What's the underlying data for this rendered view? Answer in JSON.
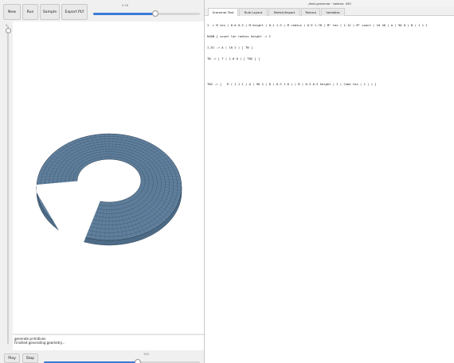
{
  "toolbar": {
    "new": "New",
    "run": "Run",
    "sample": "Sample",
    "export_ply": "Export PLY",
    "slider_value": "0.58",
    "slider_fraction": 0.58
  },
  "viewport": {
    "vertical_slider_value": "0",
    "ring_color": "#5f7f9c",
    "ring_edge_color": "#263a4d"
  },
  "console": {
    "line1": "generate primitives",
    "line2": "Finished generating geometry..."
  },
  "bottombar": {
    "play": "Play",
    "stop": "Stop",
    "slider_value": "150",
    "slider_fraction": 0.6
  },
  "editor_window": {
    "title": "./test.grammar · tokens: 450",
    "tabs": [
      "Grammar Text",
      "Rule Layout",
      "Sketch/Import",
      "Texture",
      "Variables"
    ],
    "active_tab": 0,
    "lines": [
      "I -> M tex ( 0.0 0.3 ) M height ( 0.1 1.3 ) M radius ( 0.9 1.78 ) M^ tex ( 1.12 ) M^ count ( 10 40 ) A ( 90 0 ) B ( 1 1 1",
      "RADN { count len radius height -> I",
      "I_D1 -> A ( 10 2 ) [ TN ]",
      "TN -> [ T ( 1.0 0 ) [ TN2 ] ]",
      "",
      "",
      "TN2 -> [   R ( 1 1 1 ) A ( 90 2 ) D ( 0.3 1.0 ) ( B ( 0.3 0.3 height ) I ( Cube tex ( 1 ) ) ]"
    ]
  }
}
